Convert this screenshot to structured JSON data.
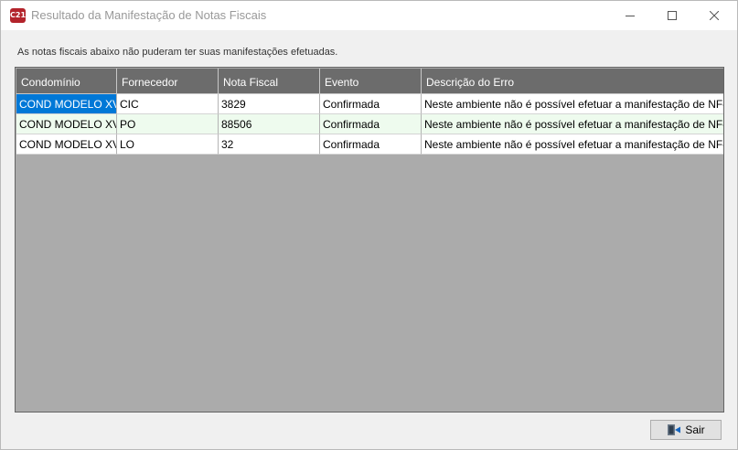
{
  "window": {
    "app_icon_text": "C21",
    "title": "Resultado da Manifestação de Notas Fiscais"
  },
  "info_text": "As notas fiscais abaixo não puderam ter suas manifestações efetuadas.",
  "grid": {
    "columns": [
      "Condomínio",
      "Fornecedor",
      "Nota Fiscal",
      "Evento",
      "Descrição do Erro"
    ],
    "rows": [
      [
        "COND MODELO XVI",
        "CIC",
        "3829",
        "Confirmada",
        "Neste ambiente não é possível efetuar a manifestação de NF-e e..."
      ],
      [
        "COND MODELO XV",
        "PO",
        "88506",
        "Confirmada",
        "Neste ambiente não é possível efetuar a manifestação de NF-e e..."
      ],
      [
        "COND MODELO XV",
        "LO",
        "32",
        "Confirmada",
        "Neste ambiente não é possível efetuar a manifestação de NF-e e..."
      ]
    ]
  },
  "buttons": {
    "exit_label": "Sair",
    "exit_icon": "exit-door-icon"
  },
  "colors": {
    "header_bg": "#6c6c6c",
    "grid_bg": "#ababab",
    "selection": "#0078d7",
    "alt_row": "#eefbee",
    "app_icon_bg": "#b3232b"
  }
}
